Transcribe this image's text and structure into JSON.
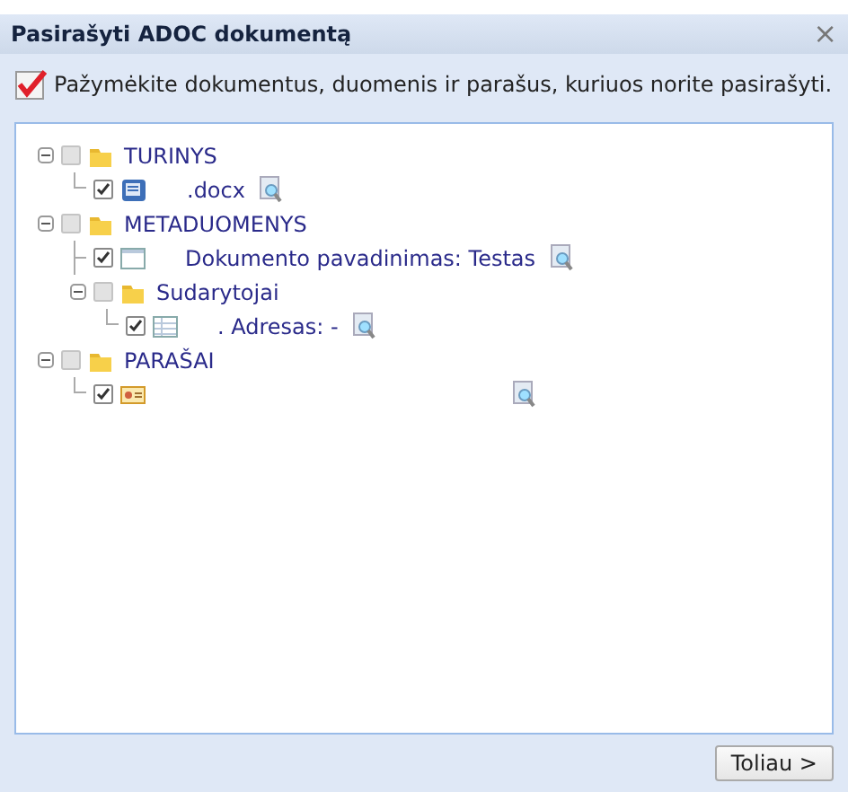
{
  "window": {
    "title": "Pasirašyti ADOC dokumentą",
    "close": "×"
  },
  "instruction": "Pažymėkite dokumentus, duomenis ir parašus, kuriuos norite pasirašyti.",
  "tree": [
    {
      "kind": "folder",
      "label": "TURINYS",
      "checked": false,
      "expanded": true,
      "children": [
        {
          "kind": "document",
          "label": ".docx",
          "checked": true,
          "preview": true
        }
      ]
    },
    {
      "kind": "folder",
      "label": "METADUOMENYS",
      "checked": false,
      "expanded": true,
      "children": [
        {
          "kind": "field",
          "label": "Dokumento pavadinimas: Testas",
          "checked": true,
          "preview": true
        },
        {
          "kind": "folder",
          "label": "Sudarytojai",
          "checked": false,
          "expanded": true,
          "children": [
            {
              "kind": "table",
              "label": ". Adresas: -",
              "checked": true,
              "preview": true
            }
          ]
        }
      ]
    },
    {
      "kind": "folder",
      "label": "PARAŠAI",
      "checked": false,
      "expanded": true,
      "children": [
        {
          "kind": "signature",
          "checked": true,
          "preview": true
        }
      ]
    }
  ],
  "buttons": [
    "Toliau >"
  ]
}
